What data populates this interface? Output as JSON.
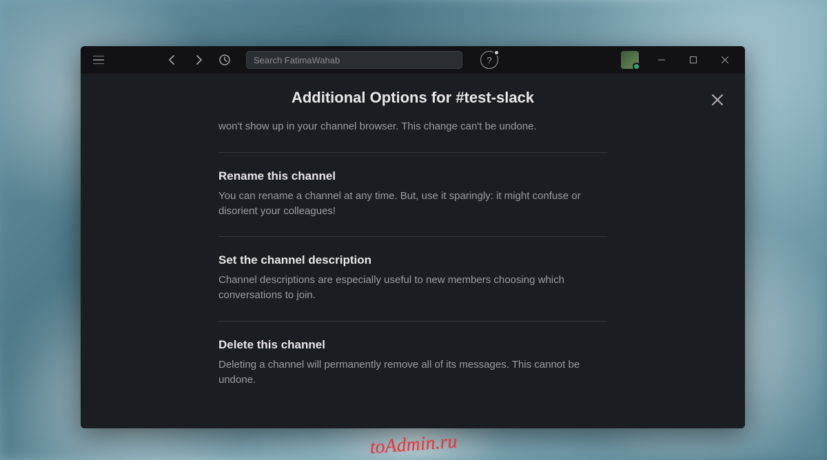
{
  "titlebar": {
    "search_placeholder": "Search FatimaWahab"
  },
  "modal": {
    "title_prefix": "Additional Options for",
    "channel_name": "#test-slack",
    "trailing_text": "won't show up in your channel browser. This change can't be undone.",
    "options": [
      {
        "title": "Rename this channel",
        "desc": "You can rename a channel at any time. But, use it sparingly: it might confuse or disorient your colleagues!"
      },
      {
        "title": "Set the channel description",
        "desc": "Channel descriptions are especially useful to new members choosing which conversations to join."
      },
      {
        "title": "Delete this channel",
        "desc": "Deleting a channel will permanently remove all of its messages. This cannot be undone."
      }
    ]
  },
  "watermark": "toAdmin.ru"
}
